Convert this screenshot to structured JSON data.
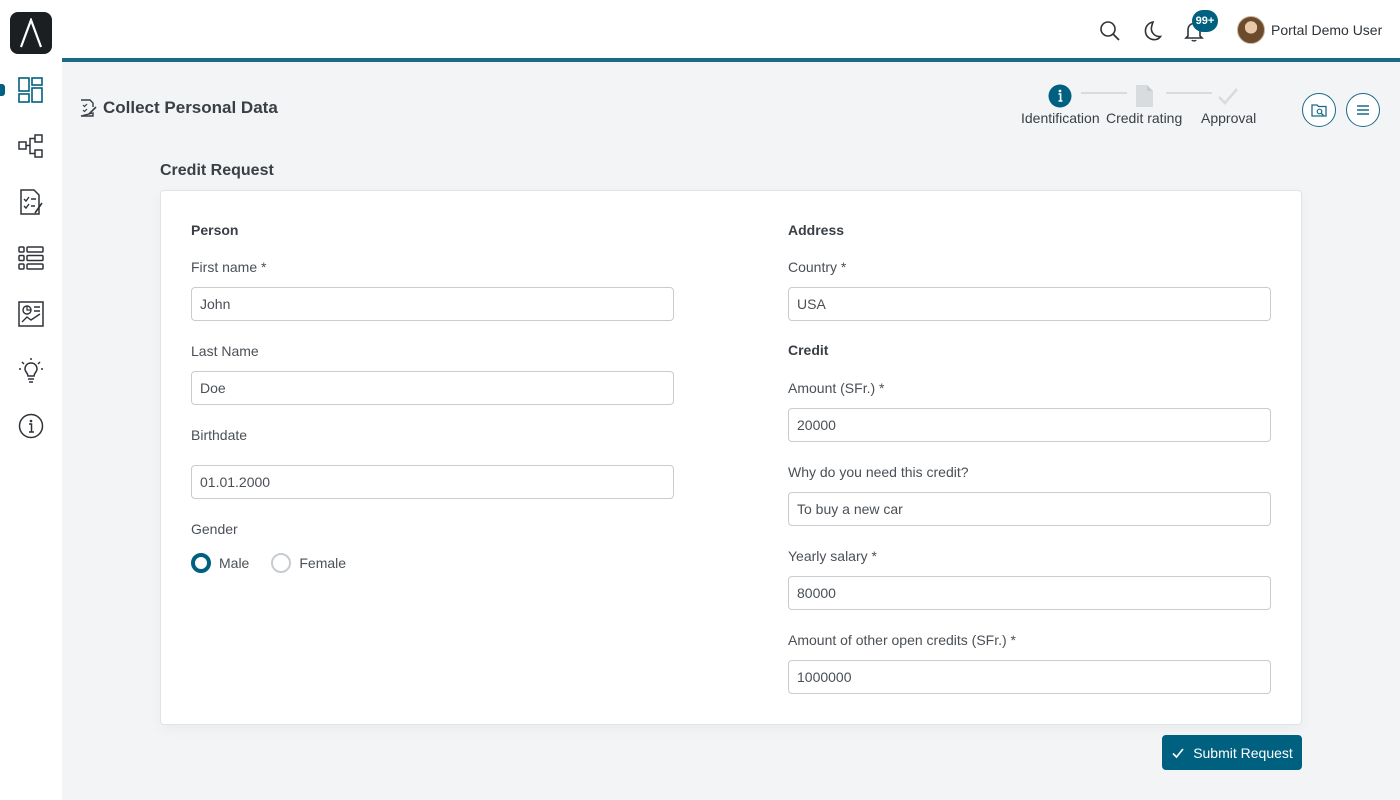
{
  "app": {
    "logo_letter": "Λ"
  },
  "header": {
    "notifications_count": "99+",
    "user_name": "Portal Demo User"
  },
  "sidebar": {
    "items": [
      {
        "name": "dashboard",
        "icon": "dashboard-icon",
        "active": true
      },
      {
        "name": "processes",
        "icon": "process-tree-icon"
      },
      {
        "name": "tasks",
        "icon": "task-list-icon"
      },
      {
        "name": "cases",
        "icon": "list-icon"
      },
      {
        "name": "statistics",
        "icon": "statistics-icon"
      },
      {
        "name": "ideas",
        "icon": "lightbulb-icon"
      },
      {
        "name": "info",
        "icon": "info-icon"
      }
    ]
  },
  "page": {
    "title": "Collect Personal Data",
    "title_icon": "edit-form-icon"
  },
  "stepper": {
    "steps": [
      {
        "label": "Identification",
        "state": "active"
      },
      {
        "label": "Credit rating",
        "state": "pending"
      },
      {
        "label": "Approval",
        "state": "pending"
      }
    ]
  },
  "form": {
    "title": "Credit Request",
    "person": {
      "section_label": "Person",
      "first_name_label": "First name  *",
      "first_name_value": "John",
      "last_name_label": "Last Name",
      "last_name_value": "Doe",
      "birthdate_label": "Birthdate",
      "birthdate_value": "01.01.2000",
      "gender_label": "Gender",
      "gender_options": [
        "Male",
        "Female"
      ],
      "gender_selected": "Male"
    },
    "address": {
      "section_label": "Address",
      "country_label": "Country  *",
      "country_value": "USA"
    },
    "credit": {
      "section_label": "Credit",
      "amount_label": "Amount (SFr.)  *",
      "amount_value": "20000",
      "reason_label": "Why do you need this credit?",
      "reason_value": "To buy a new car",
      "salary_label": "Yearly salary  *",
      "salary_value": "80000",
      "other_credits_label": "Amount of other open credits (SFr.)  *",
      "other_credits_value": "1000000"
    },
    "submit_label": "Submit Request"
  },
  "colors": {
    "accent": "#00607f",
    "header_border": "#1a6a87",
    "background": "#f2f4f6"
  }
}
